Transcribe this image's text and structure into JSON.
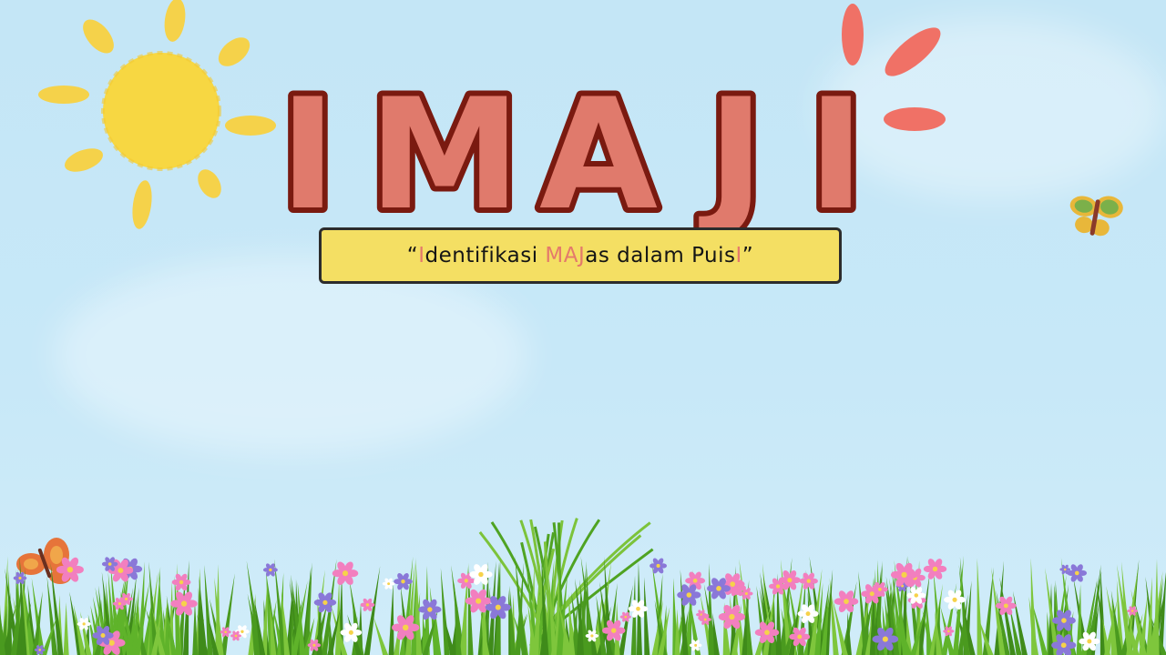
{
  "title": {
    "letters": [
      "I",
      "M",
      "A",
      "J",
      "I"
    ],
    "fill_color": "#e07a6c",
    "outline_color": "#7a1a10"
  },
  "subtitle": {
    "parts": [
      {
        "text": "“",
        "highlight": false
      },
      {
        "text": "I",
        "highlight": true
      },
      {
        "text": "dentifikasi ",
        "highlight": false
      },
      {
        "text": "MAJ",
        "highlight": true
      },
      {
        "text": "as dalam Puis",
        "highlight": false
      },
      {
        "text": "I",
        "highlight": true
      },
      {
        "text": "”",
        "highlight": false
      }
    ],
    "box_color": "#f4df63",
    "highlight_color": "#e47a6b"
  },
  "decorations": {
    "sun_color": "#f7d742",
    "ray_color": "#f5d24a",
    "flower_burst_color": "#f07166",
    "butterfly_colors": [
      "#7bb04a",
      "#e8b73a",
      "#e6743a"
    ],
    "grass_color": "#5fb32a",
    "flower_colors": [
      "#f27fbf",
      "#8a78d8",
      "#ffffff"
    ]
  }
}
